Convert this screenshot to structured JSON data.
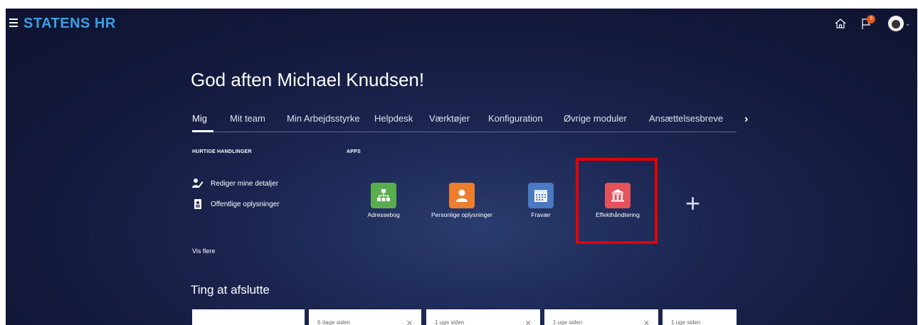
{
  "header": {
    "brand": "STATENS HR",
    "notification_count": "5"
  },
  "greeting": "God aften Michael Knudsen!",
  "tabs": [
    {
      "label": "Mig",
      "active": true
    },
    {
      "label": "Mit team"
    },
    {
      "label": "Min Arbejdsstyrke"
    },
    {
      "label": "Helpdesk"
    },
    {
      "label": "Værktøjer"
    },
    {
      "label": "Konfiguration"
    },
    {
      "label": "Øvrige moduler"
    },
    {
      "label": "Ansættelsesbreve"
    }
  ],
  "quick_actions": {
    "title": "HURTIGE HANDLINGER",
    "items": [
      {
        "label": "Rediger mine detaljer",
        "icon": "person-edit-icon"
      },
      {
        "label": "Offentlige oplysninger",
        "icon": "id-badge-icon"
      }
    ],
    "more": "Vis flere"
  },
  "apps": {
    "title": "APPS",
    "items": [
      {
        "label": "Adressebog",
        "icon": "org-chart-icon",
        "color": "#5aad4e"
      },
      {
        "label": "Personlige oplysninger",
        "icon": "person-icon",
        "color": "#ee7d2e"
      },
      {
        "label": "Fravær",
        "icon": "calendar-icon",
        "color": "#4a78c2"
      },
      {
        "label": "Effekthåndtering",
        "icon": "bank-building-icon",
        "color": "#e4525a"
      }
    ],
    "add_icon": "plus-icon"
  },
  "todo": {
    "title": "Ting at afslutte",
    "cards": [
      {
        "text": ""
      },
      {
        "text": "6 dage siden"
      },
      {
        "text": "1 uge siden"
      },
      {
        "text": "1 uge siden"
      },
      {
        "text": "1 uge siden"
      }
    ]
  },
  "colors": {
    "brand": "#3aa0e6",
    "highlight": "#e40000",
    "background": "#1b2550"
  }
}
